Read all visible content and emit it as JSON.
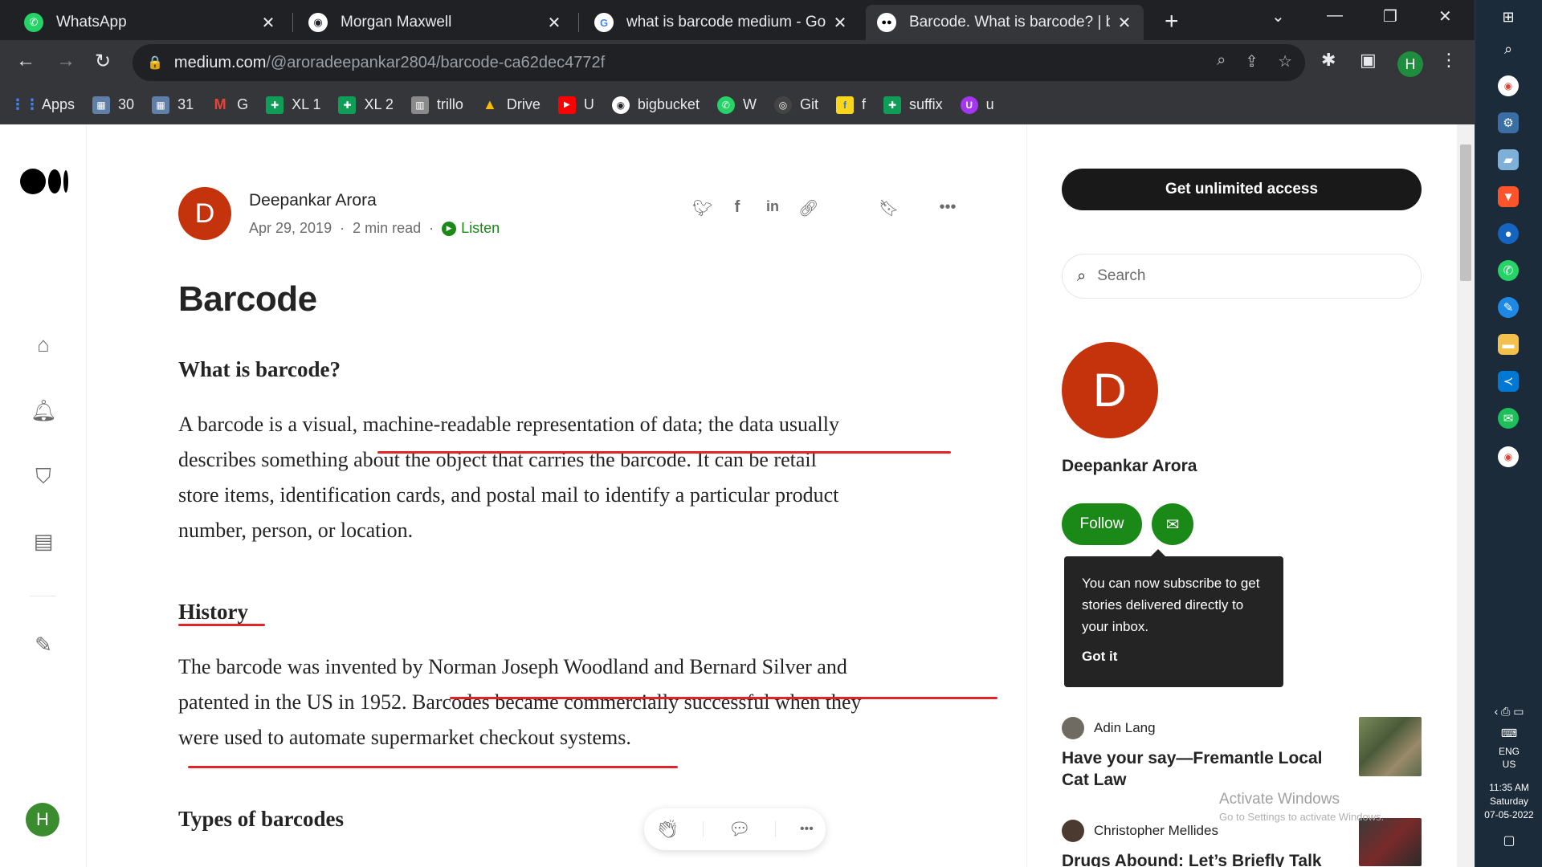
{
  "browser": {
    "tabs": [
      {
        "title": "WhatsApp",
        "favicon": "whatsapp-icon",
        "color": "#25d366"
      },
      {
        "title": "Morgan Maxwell",
        "favicon": "globe-icon",
        "color": "#ffffff"
      },
      {
        "title": "what is barcode medium - Goog",
        "favicon": "google-icon",
        "color": "#ffffff"
      },
      {
        "title": "Barcode. What is barcode? | by",
        "favicon": "medium-icon",
        "color": "#ffffff"
      }
    ],
    "url_host": "medium.com",
    "url_path": "/@aroradeepankar2804/barcode-ca62dec4772f",
    "profile_initial": "H",
    "bookmarks": [
      {
        "label": "Apps",
        "icon": "apps-grid-icon",
        "color": "#4285f4"
      },
      {
        "label": "30",
        "icon": "bookmark-icon",
        "color": "#5f7fa6"
      },
      {
        "label": "31",
        "icon": "bookmark-icon",
        "color": "#5f7fa6"
      },
      {
        "label": "G",
        "icon": "gmail-icon",
        "color": "#ea4335"
      },
      {
        "label": "XL 1",
        "icon": "sheets-icon",
        "color": "#0f9d58"
      },
      {
        "label": "XL 2",
        "icon": "sheets-icon",
        "color": "#0f9d58"
      },
      {
        "label": "trillo",
        "icon": "trello-icon",
        "color": "#8a8a8a"
      },
      {
        "label": "Drive",
        "icon": "drive-icon",
        "color": "#fbbc04"
      },
      {
        "label": "U",
        "icon": "youtube-icon",
        "color": "#ff0000"
      },
      {
        "label": "bigbucket",
        "icon": "globe-icon",
        "color": "#9aa0a6"
      },
      {
        "label": "W",
        "icon": "whatsapp-icon",
        "color": "#25d366"
      },
      {
        "label": "Git",
        "icon": "github-icon",
        "color": "#444444"
      },
      {
        "label": "f",
        "icon": "flipkart-icon",
        "color": "#f8d61c"
      },
      {
        "label": "suffix",
        "icon": "sheets-icon",
        "color": "#0f9d58"
      },
      {
        "label": "u",
        "icon": "udemy-icon",
        "color": "#a435f0"
      }
    ]
  },
  "rail": {
    "avatar_initial": "H"
  },
  "article": {
    "author_initial": "D",
    "author": "Deepankar Arora",
    "date": "Apr 29, 2019",
    "read_time": "2 min read",
    "listen": "Listen",
    "title": "Barcode",
    "h_what": "What is barcode?",
    "p1_lines": [
      "A barcode is a visual, machine-readable representation of data; the data usually",
      "describes something about the object that carries the barcode. It can be retail",
      "store items, identification cards, and postal mail to identify a particular product",
      "number, person, or location."
    ],
    "h_history": "History",
    "p2_lines": [
      "The barcode was invented by Norman Joseph Woodland and Bernard Silver and",
      "patented in the US in 1952. Barcodes became commercially successful when they",
      "were used to automate supermarket checkout systems."
    ],
    "h_types": "Types of barcodes"
  },
  "sidebar": {
    "get_access": "Get unlimited access",
    "search_placeholder": "Search",
    "author_initial": "D",
    "author": "Deepankar Arora",
    "follow": "Follow",
    "tooltip_text": "You can now subscribe to get stories delivered directly to your inbox.",
    "tooltip_action": "Got it",
    "stories": [
      {
        "author": "Adin Lang",
        "title": "Have your say—Fremantle Local Cat Law"
      },
      {
        "author": "Christopher Mellides",
        "title": "Drugs Abound: Let’s Briefly Talk"
      }
    ]
  },
  "os": {
    "watermark_title": "Activate Windows",
    "watermark_sub": "Go to Settings to activate Windows.",
    "lang1": "ENG",
    "lang2": "US",
    "time": "11:35 AM",
    "day": "Saturday",
    "date": "07-05-2022"
  },
  "colors": {
    "accent": "#1a8917",
    "avatar": "#c5330c",
    "underline": "#e0242a"
  }
}
